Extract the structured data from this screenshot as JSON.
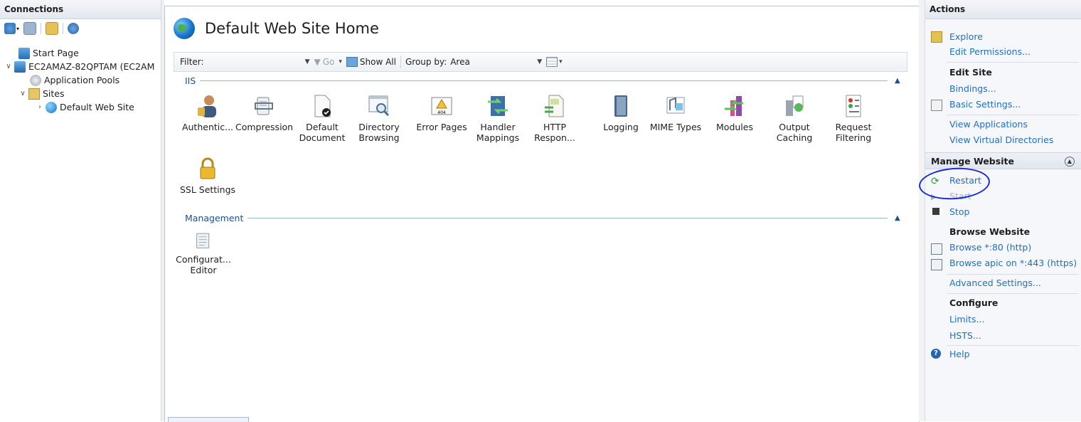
{
  "connections": {
    "header": "Connections",
    "toolbar_icons": [
      "connect-icon",
      "save-icon",
      "up-folder-icon",
      "disconnect-icon"
    ],
    "tree": [
      {
        "label": "Start Page",
        "icon": "start-page-icon"
      },
      {
        "label": "EC2AMAZ-82QPTAM (EC2AM",
        "icon": "server-icon"
      },
      {
        "label": "Application Pools",
        "icon": "app-pools-icon"
      },
      {
        "label": "Sites",
        "icon": "sites-folder-icon"
      },
      {
        "label": "Default Web Site",
        "icon": "globe-icon"
      }
    ]
  },
  "main": {
    "title": "Default Web Site Home",
    "filter": {
      "label": "Filter:",
      "value": "",
      "go_label": "Go",
      "show_all_label": "Show All",
      "group_by_label": "Group by:",
      "group_by_value": "Area"
    },
    "groups": [
      {
        "name": "IIS",
        "features": [
          {
            "label": "Authentic...",
            "icon": "authentication-icon"
          },
          {
            "label": "Compression",
            "icon": "compression-icon"
          },
          {
            "label": "Default Document",
            "icon": "default-document-icon"
          },
          {
            "label": "Directory Browsing",
            "icon": "directory-browsing-icon"
          },
          {
            "label": "Error Pages",
            "icon": "error-pages-icon"
          },
          {
            "label": "Handler Mappings",
            "icon": "handler-mappings-icon"
          },
          {
            "label": "HTTP Respon...",
            "icon": "http-response-icon"
          },
          {
            "label": "Logging",
            "icon": "logging-icon"
          },
          {
            "label": "MIME Types",
            "icon": "mime-types-icon"
          },
          {
            "label": "Modules",
            "icon": "modules-icon"
          },
          {
            "label": "Output Caching",
            "icon": "output-caching-icon"
          },
          {
            "label": "Request Filtering",
            "icon": "request-filtering-icon"
          },
          {
            "label": "SSL Settings",
            "icon": "ssl-lock-icon"
          }
        ]
      },
      {
        "name": "Management",
        "features": [
          {
            "label": "Configurat... Editor",
            "icon": "configuration-editor-icon"
          }
        ]
      }
    ]
  },
  "actions": {
    "header": "Actions",
    "explore": "Explore",
    "edit_permissions": "Edit Permissions...",
    "edit_site": "Edit Site",
    "bindings": "Bindings...",
    "basic_settings": "Basic Settings...",
    "view_applications": "View Applications",
    "view_virtual_directories": "View Virtual Directories",
    "manage_website": "Manage Website",
    "restart": "Restart",
    "start": "Start",
    "stop": "Stop",
    "browse_website": "Browse Website",
    "browse_80": "Browse *:80 (http)",
    "browse_443": "Browse apic on *:443 (https)",
    "advanced_settings": "Advanced Settings...",
    "configure": "Configure",
    "limits": "Limits...",
    "hsts": "HSTS...",
    "help": "Help",
    "annotation_color": "#1a2ad6"
  }
}
